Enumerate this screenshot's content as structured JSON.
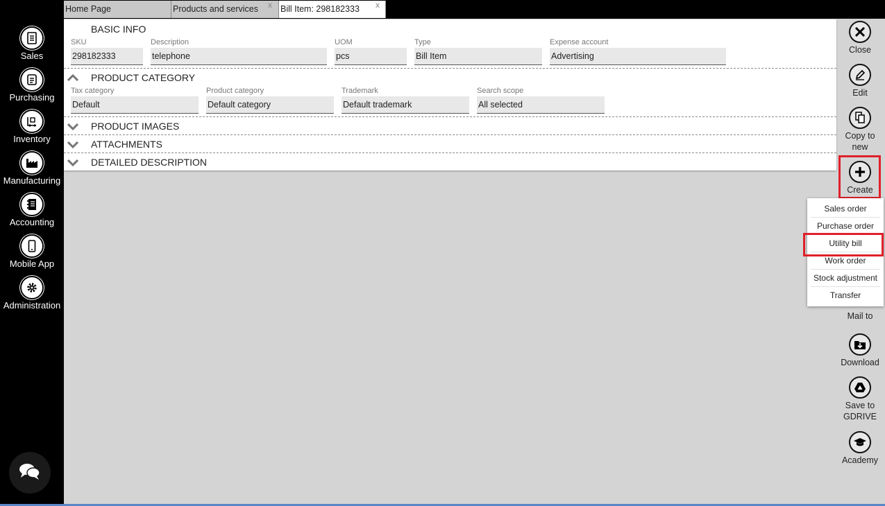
{
  "sidebar": {
    "items": [
      {
        "label": "Sales",
        "icon": "sales-doc-icon"
      },
      {
        "label": "Purchasing",
        "icon": "purchasing-icon"
      },
      {
        "label": "Inventory",
        "icon": "inventory-icon"
      },
      {
        "label": "Manufacturing",
        "icon": "factory-icon"
      },
      {
        "label": "Accounting",
        "icon": "ledger-icon"
      },
      {
        "label": "Mobile App",
        "icon": "phone-icon"
      },
      {
        "label": "Administration",
        "icon": "gear-icon"
      }
    ],
    "chat_icon": "chat-bubbles-icon"
  },
  "tabs": [
    {
      "label": "Home Page",
      "close": ""
    },
    {
      "label": "Products and services",
      "close": "x"
    },
    {
      "label": "Bill Item: 298182333",
      "close": "x"
    }
  ],
  "sections": {
    "basic_info": {
      "title": "BASIC INFO",
      "fields": {
        "sku": {
          "label": "SKU",
          "value": "298182333"
        },
        "description": {
          "label": "Description",
          "value": "telephone"
        },
        "uom": {
          "label": "UOM",
          "value": "pcs"
        },
        "type": {
          "label": "Type",
          "value": "Bill Item"
        },
        "expense_account": {
          "label": "Expense account",
          "value": "Advertising"
        }
      }
    },
    "product_category": {
      "title": "PRODUCT CATEGORY",
      "fields": {
        "tax_category": {
          "label": "Tax category",
          "value": "Default"
        },
        "product_category": {
          "label": "Product category",
          "value": "Default category"
        },
        "trademark": {
          "label": "Trademark",
          "value": "Default trademark"
        },
        "search_scope": {
          "label": "Search scope",
          "value": "All selected"
        }
      }
    },
    "product_images": {
      "title": "PRODUCT IMAGES"
    },
    "attachments": {
      "title": "ATTACHMENTS"
    },
    "detailed_description": {
      "title": "DETAILED DESCRIPTION"
    }
  },
  "toolbar": {
    "close": "Close",
    "edit": "Edit",
    "copy_line1": "Copy to",
    "copy_line2": "new",
    "create": "Create",
    "mail_to": "Mail to",
    "download": "Download",
    "save_line1": "Save to",
    "save_line2": "GDRIVE",
    "academy": "Academy"
  },
  "create_menu": {
    "items": [
      "Sales order",
      "Purchase order",
      "Utility bill",
      "Work order",
      "Stock adjustment",
      "Transfer"
    ],
    "highlighted": "Utility bill"
  },
  "colors": {
    "highlight": "#e0202a",
    "sidebar_bg": "#000000",
    "workspace_bg": "#d4d4d4"
  }
}
